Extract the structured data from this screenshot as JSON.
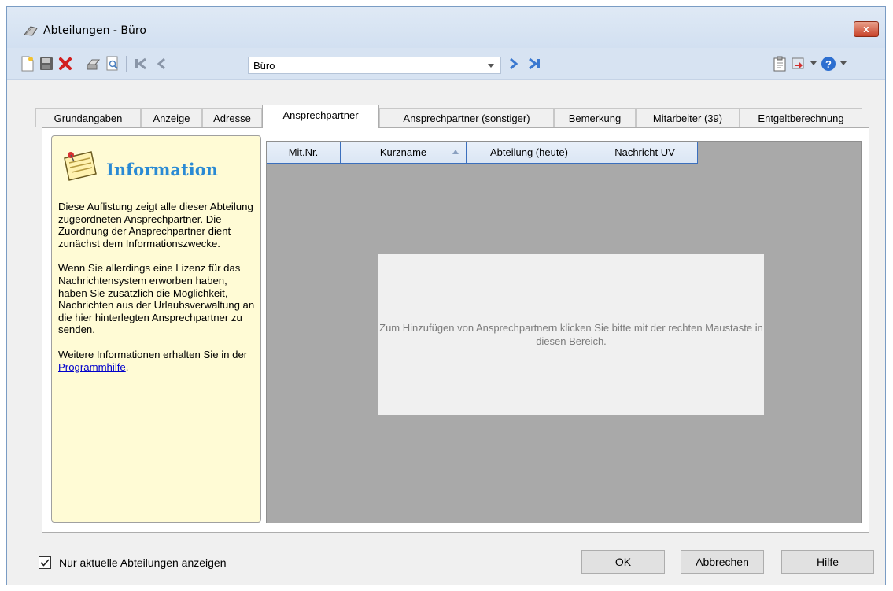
{
  "window": {
    "title": "Abteilungen - Büro",
    "close_label": "x"
  },
  "toolbar": {
    "combo_value": "Büro"
  },
  "tabs": [
    {
      "label": "Grundangaben"
    },
    {
      "label": "Anzeige"
    },
    {
      "label": "Adresse"
    },
    {
      "label": "Ansprechpartner"
    },
    {
      "label": "Ansprechpartner (sonstiger)"
    },
    {
      "label": "Bemerkung"
    },
    {
      "label": "Mitarbeiter (39)"
    },
    {
      "label": "Entgeltberechnung"
    }
  ],
  "info": {
    "title": "Information",
    "p1": "Diese Auflistung zeigt alle dieser Abteilung zugeordneten Ansprechpartner. Die Zuordnung der Ansprechpartner dient zunächst dem Informationszwecke.",
    "p2": "Wenn Sie allerdings eine Lizenz für das Nachrichtensystem erworben haben, haben Sie zusätzlich die Möglichkeit, Nachrichten aus der Urlaubsverwaltung an die hier hinterlegten Ansprechpartner zu senden.",
    "p3_prefix": "Weitere Informationen erhalten Sie in der ",
    "p3_link": "Programmhilfe",
    "p3_suffix": "."
  },
  "grid": {
    "columns": [
      "Mit.Nr.",
      "Kurzname",
      "Abteilung (heute)",
      "Nachricht UV"
    ],
    "hint": "Zum Hinzufügen von Ansprechpartnern klicken Sie bitte mit der rechten Maustaste in diesen Bereich."
  },
  "footer": {
    "checkbox_label": "Nur aktuelle Abteilungen anzeigen",
    "checkbox_checked": true,
    "ok": "OK",
    "cancel": "Abbrechen",
    "help": "Hilfe"
  }
}
